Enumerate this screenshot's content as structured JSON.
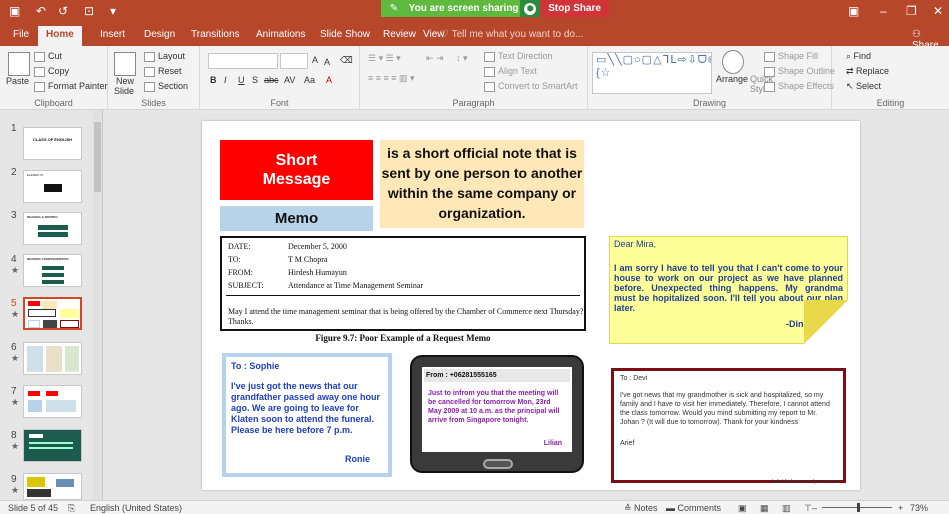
{
  "titlebar": {
    "sharing_text": "You are screen sharing",
    "stop_share_label": "Stop Share",
    "pencil_icon": "✎",
    "shield_icon": "⬢"
  },
  "tabs": [
    {
      "label": "File"
    },
    {
      "label": "Home"
    },
    {
      "label": "Insert"
    },
    {
      "label": "Design"
    },
    {
      "label": "Transitions"
    },
    {
      "label": "Animations"
    },
    {
      "label": "Slide Show"
    },
    {
      "label": "Review"
    },
    {
      "label": "View"
    }
  ],
  "tell_me": "Tell me what you want to do...",
  "share_label": "Share",
  "ribbon": {
    "clipboard": {
      "cut": "Cut",
      "copy": "Copy",
      "paste": "Paste",
      "format_painter": "Format Painter",
      "label": "Clipboard"
    },
    "slides": {
      "new_slide": "New",
      "new_slide_sub": "Slide",
      "layout": "Layout",
      "reset": "Reset",
      "section": "Section",
      "label": "Slides"
    },
    "font": {
      "label": "Font",
      "bold": "B",
      "italic": "I",
      "underline": "U",
      "shadow": "S",
      "strike": "abc",
      "spacing": "AV",
      "case": "Aa",
      "color": "A",
      "grow": "A",
      "shrink": "A"
    },
    "paragraph": {
      "text_direction": "Text Direction",
      "align_text": "Align Text",
      "convert_smartart": "Convert to SmartArt",
      "label": "Paragraph"
    },
    "drawing": {
      "shapes": "▭╲╲▢○▢△ᒣᒪ⇨⇩ᗜ⌬⌒⌒(){☆",
      "arrange": "Arrange",
      "quick_styles": "Quick",
      "quick_styles_sub": "Styles",
      "shape_fill": "Shape Fill",
      "shape_outline": "Shape Outline",
      "shape_effects": "Shape Effects",
      "label": "Drawing"
    },
    "editing": {
      "find": "Find",
      "replace": "Replace",
      "select": "Select",
      "label": "Editing"
    }
  },
  "thumbnails": [
    {
      "num": "1",
      "title": "CLASS OF ENGLISH"
    },
    {
      "num": "2",
      "title": "ELEMENTS"
    },
    {
      "num": "3",
      "title": "READING & WRITING"
    },
    {
      "num": "4",
      "title": "READING COMPREHENSION"
    },
    {
      "num": "5",
      "title": ""
    },
    {
      "num": "6",
      "title": ""
    },
    {
      "num": "7",
      "title": ""
    },
    {
      "num": "8",
      "title": ""
    },
    {
      "num": "9",
      "title": ""
    }
  ],
  "slide": {
    "red_box": {
      "line1": "Short",
      "line2": "Message"
    },
    "memo_label": "Memo",
    "definition": "is a short official note that is sent by one person to another within the same company or organization.",
    "memo_doc": {
      "date_key": "DATE:",
      "date": "December 5, 2000",
      "to_key": "TO:",
      "to": "T M Chopra",
      "from_key": "FROM:",
      "from": "Hirdesh Humayun",
      "subject_key": "SUBJECT:",
      "subject": "Attendance at Time Management Seminar",
      "body": "May I attend the time management seminar that is being offered by the Chamber of Commerce next Thursday? Thanks.",
      "caption": "Figure 9.7: Poor Example of a Request Memo"
    },
    "dinda_note": {
      "greeting": "Dear Mira,",
      "body": "I am sorry I have to tell you that I can't come to your house to work on our project as we have planned before. Unexpected thing happens. My grandma must be hopitalized soon. I'll tell you about our plan later.",
      "sign": "-Dinda-"
    },
    "sophie_note": {
      "to": "To : Sophie",
      "body": "I've just got the news that our grandfather passed away one hour ago. We are going to leave for Klaten soon to attend the funeral. Please be here before 7 p.m.",
      "sign": "Ronie"
    },
    "phone": {
      "from": "From : +06281555165",
      "message": "Just to infrom you that the meeting will be cancelled for tomorrow Mon, 23rd May 2009 at 10 a.m. as the principal will arrive from Singapore tonight.",
      "sign": "Lilian"
    },
    "devi_note": {
      "to": "To : Devi",
      "body": "I've got news that my grandmother is sick and hospitalized, so my family and I have to visit her immediately. Therefore, I cannot attend the class tomorrow. Would you mind submitting my report to Mr. Johan ? (It will due to tomorrow). Thank for your kindness",
      "sign": "Arief"
    },
    "credit": "kuliahfarhana.wordpress.com"
  },
  "status": {
    "slide_of": "Slide 5 of 45",
    "language": "English (United States)",
    "notes": "Notes",
    "comments": "Comments",
    "zoom": "73%"
  }
}
